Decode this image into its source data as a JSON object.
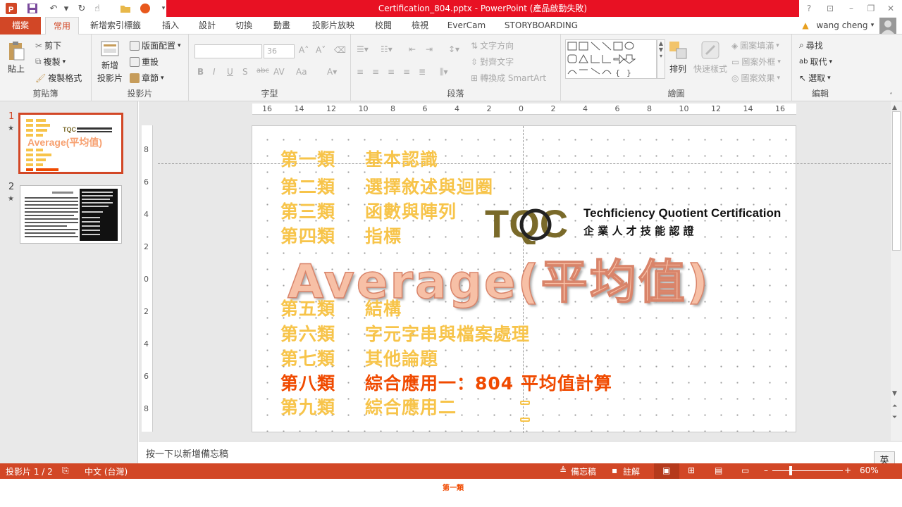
{
  "title": "Certification_804.pptx - PowerPoint (產品啟動失敗)",
  "window_buttons": [
    "?",
    "⊡",
    "–",
    "❐",
    "✕"
  ],
  "tabs": {
    "file": "檔案",
    "home": "常用",
    "items": [
      "新增索引標籤",
      "插入",
      "設計",
      "切換",
      "動畫",
      "投影片放映",
      "校閱",
      "檢視",
      "EverCam",
      "STORYBOARDING"
    ]
  },
  "user": "wang cheng",
  "ribbon": {
    "clipboard": {
      "label": "剪貼簿",
      "paste": "貼上",
      "cut": "剪下",
      "copy": "複製",
      "format": "複製格式"
    },
    "slides": {
      "label": "投影片",
      "new_slide_1": "新增",
      "new_slide_2": "投影片",
      "layout": "版面配置",
      "reset": "重設",
      "section": "章節"
    },
    "font": {
      "label": "字型",
      "size": "36",
      "bold": "B",
      "italic": "I",
      "underline": "U",
      "shadow": "S",
      "strike": "abc",
      "spacing": "AV",
      "case": "Aa"
    },
    "paragraph": {
      "label": "段落",
      "text_direction": "文字方向",
      "align_text": "對齊文字",
      "smartart": "轉換成 SmartArt"
    },
    "drawing": {
      "label": "繪圖",
      "arrange": "排列",
      "quick_styles": "快速樣式",
      "fill": "圖案填滿",
      "outline": "圖案外框",
      "effects": "圖案效果"
    },
    "editing": {
      "label": "編輯",
      "find": "尋找",
      "replace": "取代",
      "select": "選取"
    }
  },
  "thumbnails": [
    {
      "num": "1",
      "star": "★"
    },
    {
      "num": "2",
      "star": "★"
    }
  ],
  "slide": {
    "categories": [
      {
        "num": "第一類",
        "name": "基本認識"
      },
      {
        "num": "第二類",
        "name": "選擇敘述與迴圈"
      },
      {
        "num": "第三類",
        "name": "函數與陣列"
      },
      {
        "num": "第四類",
        "name": "指標"
      },
      {
        "num": "第五類",
        "name": "結構"
      },
      {
        "num": "第六類",
        "name": "字元字串與檔案處理"
      },
      {
        "num": "第七類",
        "name": "其他論題"
      },
      {
        "num": "第八類",
        "name": "綜合應用一：804 平均值計算"
      },
      {
        "num": "第九類",
        "name": "綜合應用二"
      }
    ],
    "big_title": "Average(平均值)",
    "logo_mark": "TQC",
    "logo_en": "Techficiency Quotient Certification",
    "logo_zh": "企 業 人 才 技 能 認 證"
  },
  "ruler_h": [
    "16",
    "14",
    "12",
    "10",
    "8",
    "6",
    "4",
    "2",
    "0",
    "2",
    "4",
    "6",
    "8",
    "10",
    "12",
    "14",
    "16"
  ],
  "ruler_v": [
    "8",
    "6",
    "4",
    "2",
    "0",
    "2",
    "4",
    "6",
    "8"
  ],
  "notes_placeholder": "按一下以新增備忘稿",
  "status": {
    "slide": "投影片 1 / 2",
    "language": "中文 (台灣)",
    "notes": "備忘稿",
    "comments": "註解",
    "zoom": "60%",
    "ime": "英"
  },
  "bottom_caption": "第一類",
  "colors": {
    "accent": "#d24726",
    "category": "#f7c44a",
    "current": "#f04a00",
    "title": "#f7c0a6"
  }
}
